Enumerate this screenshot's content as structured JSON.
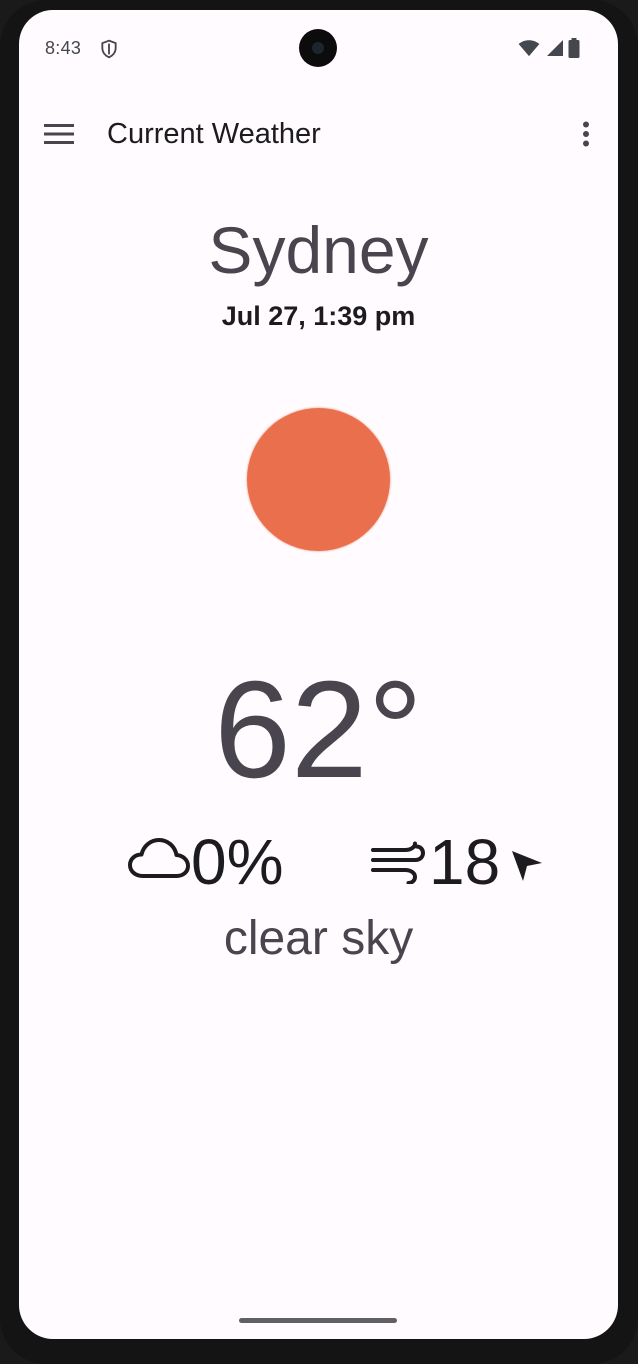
{
  "status_bar": {
    "time": "8:43",
    "icons": [
      "shield-icon",
      "wifi-icon",
      "signal-icon",
      "battery-icon"
    ]
  },
  "app_bar": {
    "title": "Current Weather",
    "menu_icon": "hamburger-menu-icon",
    "more_icon": "more-vert-icon"
  },
  "weather": {
    "city": "Sydney",
    "datetime": "Jul 27, 1:39 pm",
    "condition_icon": "sun-icon",
    "temperature": "62°",
    "cloud_cover": "0%",
    "wind_speed": "18",
    "description": "clear sky"
  },
  "colors": {
    "background": "#fffbfe",
    "sun": "#ea704d",
    "primary_text": "#1c1b1f",
    "secondary_text": "#49454f"
  }
}
